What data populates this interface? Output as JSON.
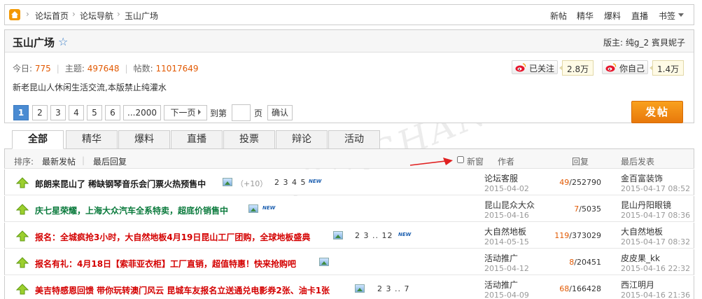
{
  "topbar": {
    "breadcrumbs": [
      "论坛首页",
      "论坛导航",
      "玉山广场"
    ],
    "links": [
      "新帖",
      "精华",
      "爆料",
      "直播"
    ],
    "bookmark_label": "书签"
  },
  "forum": {
    "title": "玉山广场",
    "moderator_label": "版主:",
    "moderators": "纯g_2 賓貝妮子",
    "today_label": "今日:",
    "today": "775",
    "topics_label": "主题:",
    "topics": "497648",
    "posts_label": "帖数:",
    "posts": "11017649",
    "description": "新老昆山人休闲生活交流,本版禁止纯灌水",
    "follow_label": "已关注",
    "follow_count": "2.8万",
    "self_label": "你自己",
    "self_count": "1.4万"
  },
  "pager": {
    "pages": [
      "1",
      "2",
      "3",
      "4",
      "5",
      "6",
      "...2000"
    ],
    "next_label": "下一页",
    "goto_label": "到第",
    "page_unit": "页",
    "confirm_label": "确认",
    "post_button": "发帖"
  },
  "tabs": [
    "全部",
    "精华",
    "爆料",
    "直播",
    "投票",
    "辩论",
    "活动"
  ],
  "list_header": {
    "sort_label": "排序:",
    "sort_latest": "最新发帖",
    "sort_reply": "最后回复",
    "new_window": "新窗",
    "author": "作者",
    "reply": "回复",
    "last_post": "最后发表"
  },
  "threads": [
    {
      "title": "郎朗来昆山了 稀缺钢琴音乐会门票火热预售中",
      "plus": "（+10）",
      "pages": "2 3 4 5",
      "author": "论坛客服",
      "author_date": "2015-04-02",
      "replies": "49",
      "views": "/252790",
      "last_user": "金百富装饰",
      "last_date": "2015-04-17 08:52"
    },
    {
      "title": "庆七星荣耀，上海大众汽车全系特卖，超底价销售中",
      "author": "昆山昆众大众",
      "author_date": "2015-04-16",
      "replies": "7",
      "views": "/5035",
      "last_user": "昆山丹阳眼镜",
      "last_date": "2015-04-17 08:36"
    },
    {
      "title": "报名：全城疯抢3小时，大自然地板4月19日昆山工厂团购，全球地板盛典",
      "pages": "2 3 .. 12",
      "author": "大自然地板",
      "author_date": "2014-05-15",
      "replies": "119",
      "views": "/373029",
      "last_user": "大自然地板",
      "last_date": "2015-04-17 08:32"
    },
    {
      "title": "报名有礼：4月18日【索菲亚衣柜】工厂直销，超值特惠！快来抢购吧",
      "author": "活动推广",
      "author_date": "2015-04-12",
      "replies": "8",
      "views": "/20451",
      "last_user": "皮皮果_kk",
      "last_date": "2015-04-16 22:32"
    },
    {
      "title": "美吉特感恩回馈 带你玩转澳门风云 昆城车友报名立送通兑电影券2张、油卡1张",
      "pages": "2 3 .. 7",
      "author": "活动推广",
      "author_date": "2015-04-09",
      "replies": "68",
      "views": "/166428",
      "last_user": "西江明月",
      "last_date": "2015-04-16 21:36"
    }
  ],
  "watermark": "KUNSHAN BBS",
  "new_badge": "NEW",
  "colors": {
    "accent_blue": "#4a8bd2",
    "post_orange": "#f08c12",
    "title_black": "#1a1a1a",
    "title_green": "#0a7a3c",
    "title_red": "#d40000",
    "number_orange": "#e25a04"
  }
}
